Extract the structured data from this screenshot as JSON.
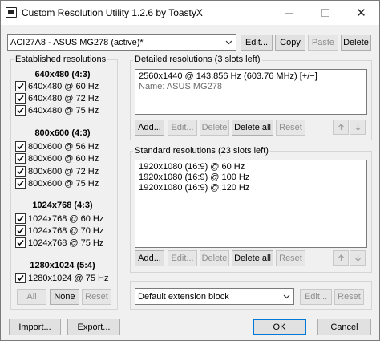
{
  "window": {
    "title": "Custom Resolution Utility 1.2.6 by ToastyX"
  },
  "monitor_select": {
    "value": "ACI27A8 - ASUS MG278 (active)*"
  },
  "top_buttons": {
    "edit": "Edit...",
    "copy": "Copy",
    "paste": "Paste",
    "delete": "Delete"
  },
  "established": {
    "title": "Established resolutions",
    "groups": [
      {
        "header": "640x480 (4:3)",
        "items": [
          "640x480 @ 60 Hz",
          "640x480 @ 72 Hz",
          "640x480 @ 75 Hz"
        ]
      },
      {
        "header": "800x600 (4:3)",
        "items": [
          "800x600 @ 56 Hz",
          "800x600 @ 60 Hz",
          "800x600 @ 72 Hz",
          "800x600 @ 75 Hz"
        ]
      },
      {
        "header": "1024x768 (4:3)",
        "items": [
          "1024x768 @ 60 Hz",
          "1024x768 @ 70 Hz",
          "1024x768 @ 75 Hz"
        ]
      },
      {
        "header": "1280x1024 (5:4)",
        "items": [
          "1280x1024 @ 75 Hz"
        ]
      }
    ],
    "buttons": {
      "all": "All",
      "none": "None",
      "reset": "Reset"
    }
  },
  "detailed": {
    "title": "Detailed resolutions (3 slots left)",
    "items": [
      "2560x1440 @ 143.856 Hz (603.76 MHz) [+/−]",
      "Name: ASUS MG278"
    ],
    "buttons": {
      "add": "Add...",
      "edit": "Edit...",
      "delete": "Delete",
      "delete_all": "Delete all",
      "reset": "Reset"
    }
  },
  "standard": {
    "title": "Standard resolutions (23 slots left)",
    "items": [
      "1920x1080 (16:9) @ 60 Hz",
      "1920x1080 (16:9) @ 100 Hz",
      "1920x1080 (16:9) @ 120 Hz"
    ],
    "buttons": {
      "add": "Add...",
      "edit": "Edit...",
      "delete": "Delete",
      "delete_all": "Delete all",
      "reset": "Reset"
    }
  },
  "extension_select": {
    "value": "Default extension block"
  },
  "extension_buttons": {
    "edit": "Edit...",
    "reset": "Reset"
  },
  "bottom_buttons": {
    "import": "Import...",
    "export": "Export...",
    "ok": "OK",
    "cancel": "Cancel"
  }
}
